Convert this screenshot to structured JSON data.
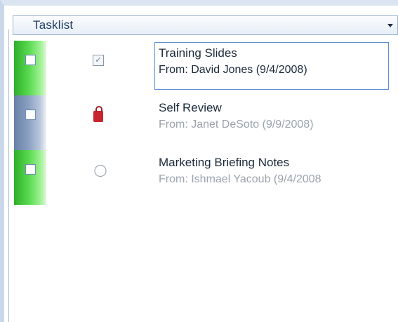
{
  "header": {
    "title": "Tasklist"
  },
  "tasks": [
    {
      "subject": "Training Slides",
      "from": "From: David Jones (9/4/2008)",
      "type_icon": "task-icon",
      "flag_color": "#57d94e",
      "selected": true
    },
    {
      "subject": "Self Review",
      "from": "From: Janet DeSoto (9/9/2008)",
      "type_icon": "lock-icon",
      "flag_color": "#8ba0c2",
      "selected": false
    },
    {
      "subject": "Marketing Briefing Notes",
      "from": "From: Ishmael Yacoub (9/4/2008",
      "type_icon": "user-icon",
      "flag_color": "#57d94e",
      "selected": false
    }
  ],
  "colors": {
    "selection_border": "#5b8fd2",
    "header_text": "#1e3d66"
  }
}
